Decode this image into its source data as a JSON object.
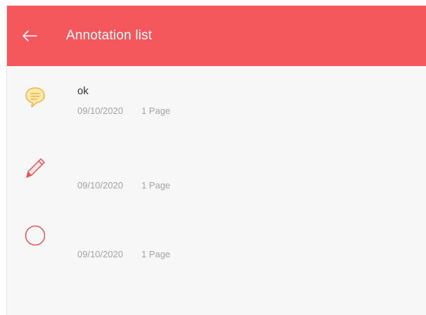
{
  "header": {
    "title": "Annotation list",
    "back_icon": "arrow-left-icon",
    "background": "#f4585c"
  },
  "annotations": [
    {
      "icon": "comment-bubble-icon",
      "icon_color": "#f5b333",
      "text": "ok",
      "date": "09/10/2020",
      "pages": "1 Page"
    },
    {
      "icon": "pencil-icon",
      "icon_color": "#e2575c",
      "text": "",
      "date": "09/10/2020",
      "pages": "1 Page"
    },
    {
      "icon": "circle-shape-icon",
      "icon_color": "#e2575c",
      "text": "",
      "date": "09/10/2020",
      "pages": "1 Page"
    }
  ]
}
